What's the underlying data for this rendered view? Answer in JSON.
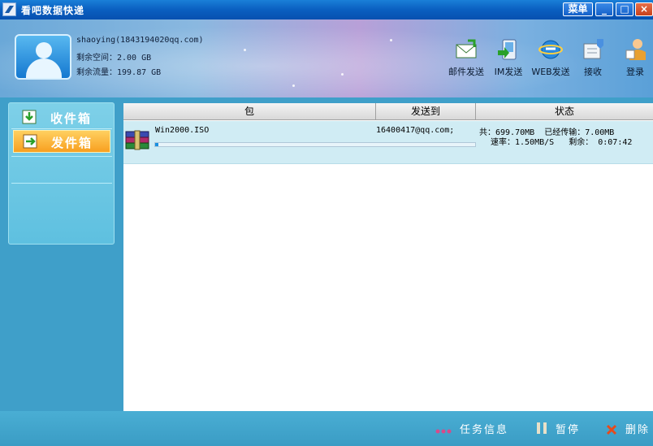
{
  "window": {
    "title": "看吧数据快递",
    "menu_label": "菜单",
    "minimize_label": "_",
    "maximize_label": "□",
    "close_label": "×"
  },
  "account": {
    "user": "shaoying(1843194020qq.com)",
    "space": "剩余空间：2.00 GB",
    "traffic": "剩余流量：199.87 GB"
  },
  "toolbar": {
    "items": [
      {
        "label": "邮件发送",
        "icon": "mail-send-icon"
      },
      {
        "label": "IM发送",
        "icon": "im-send-icon"
      },
      {
        "label": "WEB发送",
        "icon": "web-send-icon"
      },
      {
        "label": "接收",
        "icon": "receive-icon"
      },
      {
        "label": "登录",
        "icon": "login-icon"
      }
    ]
  },
  "sidebar": {
    "items": [
      {
        "label": "收件箱",
        "icon": "inbox-icon",
        "selected": false
      },
      {
        "label": "发件箱",
        "icon": "outbox-icon",
        "selected": true
      }
    ]
  },
  "table": {
    "columns": [
      "包",
      "发送到",
      "状态"
    ],
    "rows": [
      {
        "filename": "Win2000.ISO",
        "recipient": "16400417@qq.com;",
        "status_line1": "共：699.70MB  已经传输：7.00MB",
        "status_line2": "速率：1.50MB/S   剩余： 0:07:42",
        "progress": 0.01
      }
    ]
  },
  "bottom": {
    "task_info": "任务信息",
    "pause": "暂停",
    "delete": "删除"
  },
  "colors": {
    "accent": "#1a7fd8",
    "outbox_selected": "#f8a020",
    "progress": "#1a90e0"
  }
}
